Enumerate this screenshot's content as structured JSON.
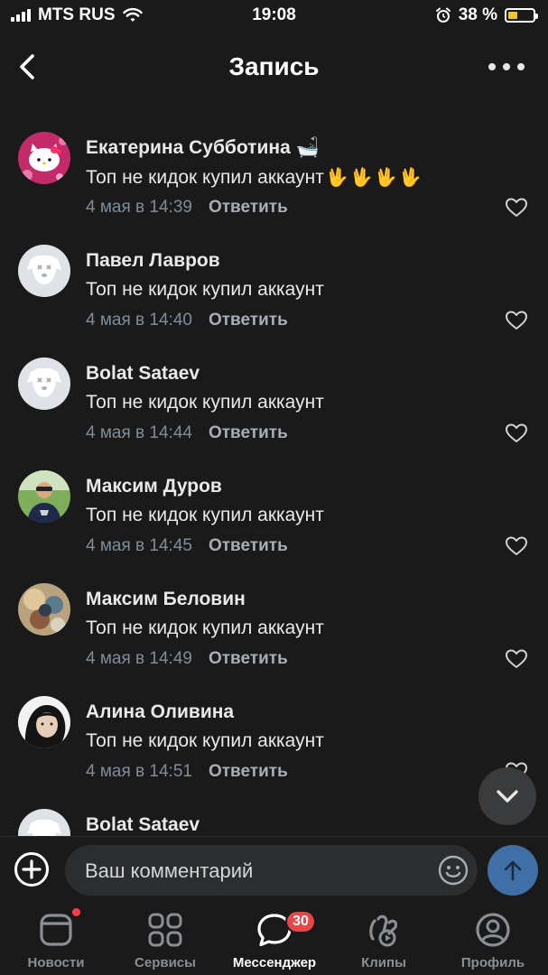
{
  "status_bar": {
    "carrier": "MTS RUS",
    "time": "19:08",
    "battery_percent": "38 %",
    "battery_level": 0.38
  },
  "header": {
    "title": "Запись",
    "back_icon": "chevron-left-icon",
    "more_icon": "more-horizontal-icon"
  },
  "comments": [
    {
      "name": "Екатерина Субботина",
      "name_emoji": "🛁",
      "text": "Топ не кидок купил аккаунт",
      "hands": [
        "🖖",
        "🖖",
        "🖖",
        "🖖"
      ],
      "date": "4 мая в 14:39",
      "reply": "Ответить",
      "avatar": "hello-kitty"
    },
    {
      "name": "Павел Лавров",
      "text": "Топ не кидок купил аккаунт",
      "date": "4 мая в 14:40",
      "reply": "Ответить",
      "avatar": "deactivated-dog"
    },
    {
      "name": "Bolat Sataev",
      "text": "Топ не кидок купил аккаунт",
      "date": "4 мая в 14:44",
      "reply": "Ответить",
      "avatar": "deactivated-dog"
    },
    {
      "name": "Максим Дуров",
      "text": "Топ не кидок купил аккаунт",
      "date": "4 мая в 14:45",
      "reply": "Ответить",
      "avatar": "photo-man"
    },
    {
      "name": "Максим Беловин",
      "text": "Топ не кидок купил аккаунт",
      "date": "4 мая в 14:49",
      "reply": "Ответить",
      "avatar": "photo-colorful"
    },
    {
      "name": "Алина Оливина",
      "text": "Топ не кидок купил аккаунт",
      "date": "4 мая в 14:51",
      "reply": "Ответить",
      "avatar": "photo-woman"
    },
    {
      "name": "Bolat Sataev",
      "text": "",
      "date": "",
      "reply": "",
      "avatar": "deactivated-dog"
    }
  ],
  "composer": {
    "placeholder": "Ваш комментарий"
  },
  "tabbar": {
    "items": [
      {
        "label": "Новости",
        "icon": "news-icon",
        "has_dot": true
      },
      {
        "label": "Сервисы",
        "icon": "services-grid-icon"
      },
      {
        "label": "Мессенджер",
        "icon": "messenger-icon",
        "badge": "30",
        "active": true
      },
      {
        "label": "Клипы",
        "icon": "clips-icon"
      },
      {
        "label": "Профиль",
        "icon": "profile-icon"
      }
    ]
  },
  "colors": {
    "background": "#1a1a1b",
    "secondary_text": "#818c99",
    "accent_send": "#3f6fa6",
    "badge": "#e64646",
    "battery": "#f4c430"
  }
}
